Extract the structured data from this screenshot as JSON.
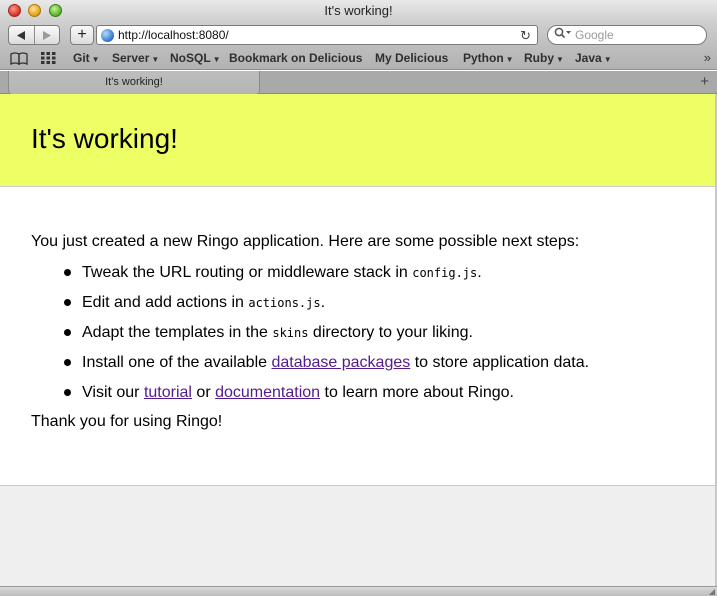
{
  "window": {
    "title": "It's working!"
  },
  "toolbar": {
    "back_icon": "back-arrow-icon",
    "forward_icon": "forward-arrow-icon",
    "add_label": "+",
    "url": "http://localhost:8080/",
    "search_placeholder": "Google"
  },
  "bookmarks": {
    "items": [
      {
        "label": "Git",
        "menu": true
      },
      {
        "label": "Server",
        "menu": true
      },
      {
        "label": "NoSQL",
        "menu": true
      },
      {
        "label": "Bookmark on Delicious",
        "menu": false
      },
      {
        "label": "My Delicious",
        "menu": false
      },
      {
        "label": "Python",
        "menu": true
      },
      {
        "label": "Ruby",
        "menu": true
      },
      {
        "label": "Java",
        "menu": true
      }
    ]
  },
  "tabs": {
    "active_label": "It's working!"
  },
  "page": {
    "heading": "It's working!",
    "intro": "You just created a new Ringo application. Here are some possible next steps:",
    "steps": {
      "s1_before": "Tweak the URL routing or middleware stack in ",
      "s1_code": "config.js",
      "s1_after": ".",
      "s2_before": "Edit and add actions in ",
      "s2_code": "actions.js",
      "s2_after": ".",
      "s3_before": "Adapt the templates in the ",
      "s3_code": "skins",
      "s3_after": " directory to your liking.",
      "s4_before": "Install one of the available ",
      "s4_link": "database packages",
      "s4_after": " to store application data.",
      "s5_before": "Visit our ",
      "s5_link1": "tutorial",
      "s5_mid": " or ",
      "s5_link2": "documentation",
      "s5_after": " to learn more about Ringo."
    },
    "thanks": "Thank you for using Ringo!"
  },
  "colors": {
    "header_bg": "#eeff66",
    "visited_link": "#551a8b"
  }
}
